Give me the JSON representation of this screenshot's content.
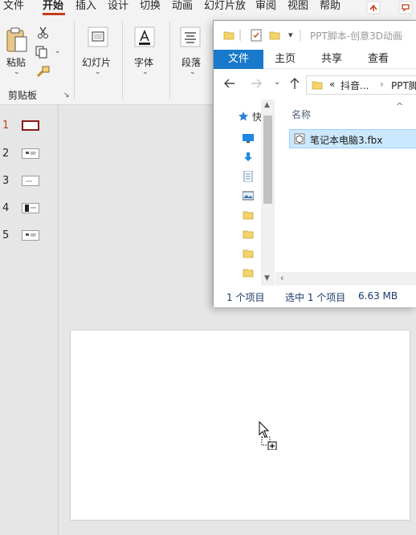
{
  "ppt": {
    "menu_tabs": [
      "文件",
      "开始",
      "插入",
      "设计",
      "切换",
      "动画",
      "幻灯片放",
      "审阅",
      "视图",
      "帮助"
    ],
    "active_tab": "开始",
    "accent": "#c43e1c",
    "ribbon": {
      "paste_label": "粘贴",
      "clipboard_group": "剪贴板",
      "slides_label": "幻灯片",
      "font_label": "字体",
      "paragraph_label": "段落"
    },
    "thumbnails": [
      "1",
      "2",
      "3",
      "4",
      "5"
    ],
    "active_slide": "1"
  },
  "explorer": {
    "title": "PPT脚本-创意3D动画",
    "ribbon_tabs": {
      "file": "文件",
      "home": "主页",
      "share": "共享",
      "view": "查看"
    },
    "file_tab_color": "#1979ca",
    "address": {
      "prefix": "«",
      "crumb1": "抖音...",
      "sep": "›",
      "crumb2": "PPT脚"
    },
    "column_header": "名称",
    "files": [
      {
        "name": "笔记本电脑3.fbx",
        "selected": true
      }
    ],
    "nav_first_label": "快",
    "status": {
      "item_count": "1 个项目",
      "selection": "选中 1 个项目",
      "size": "6.63 MB"
    }
  }
}
